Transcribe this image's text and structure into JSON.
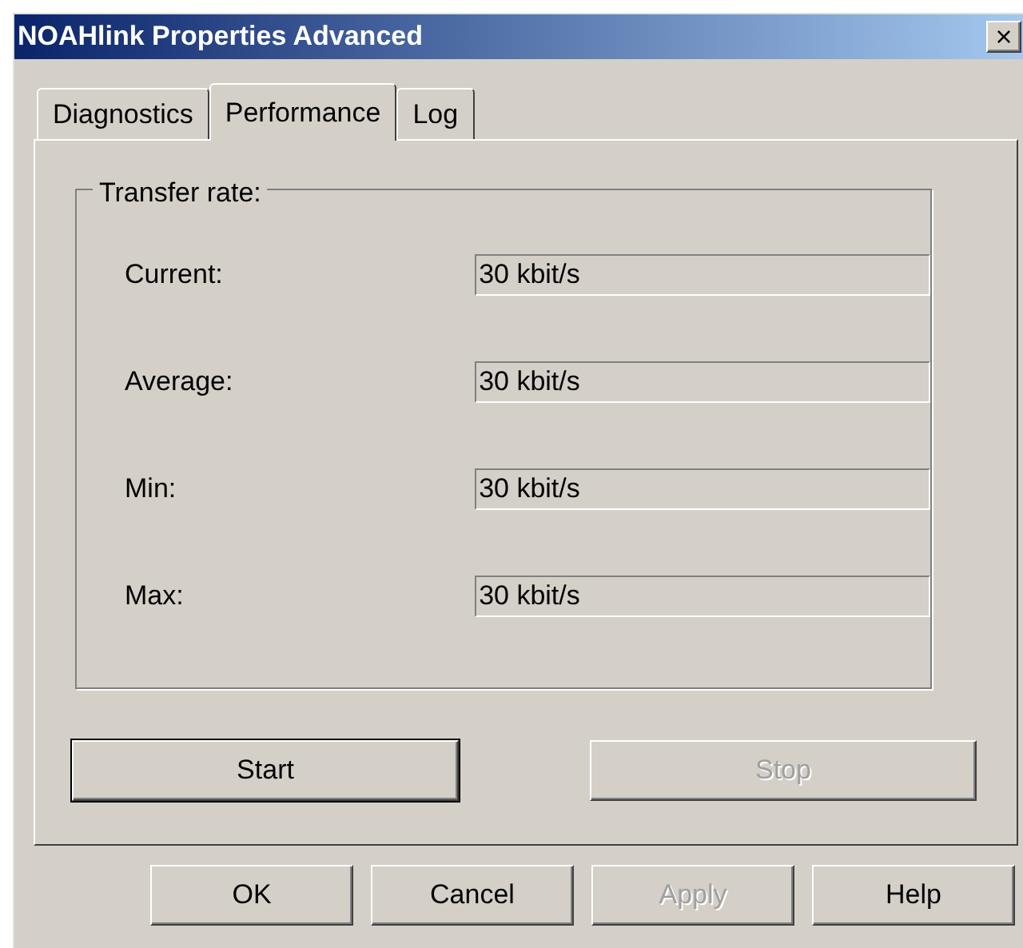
{
  "window": {
    "title": "NOAHlink Properties Advanced",
    "close": "×"
  },
  "tabs": [
    {
      "label": "Diagnostics",
      "selected": false
    },
    {
      "label": "Performance",
      "selected": true
    },
    {
      "label": "Log",
      "selected": false
    }
  ],
  "group": {
    "title": "Transfer rate:",
    "fields": [
      {
        "label": "Current:",
        "value": "30 kbit/s"
      },
      {
        "label": "Average:",
        "value": "30 kbit/s"
      },
      {
        "label": "Min:",
        "value": "30 kbit/s"
      },
      {
        "label": "Max:",
        "value": "30 kbit/s"
      }
    ]
  },
  "actions": [
    {
      "label": "Start",
      "disabled": false,
      "default": true
    },
    {
      "label": "Stop",
      "disabled": true,
      "default": false
    }
  ],
  "buttons": [
    {
      "label": "OK",
      "disabled": false
    },
    {
      "label": "Cancel",
      "disabled": false
    },
    {
      "label": "Apply",
      "disabled": true
    },
    {
      "label": "Help",
      "disabled": false
    }
  ]
}
